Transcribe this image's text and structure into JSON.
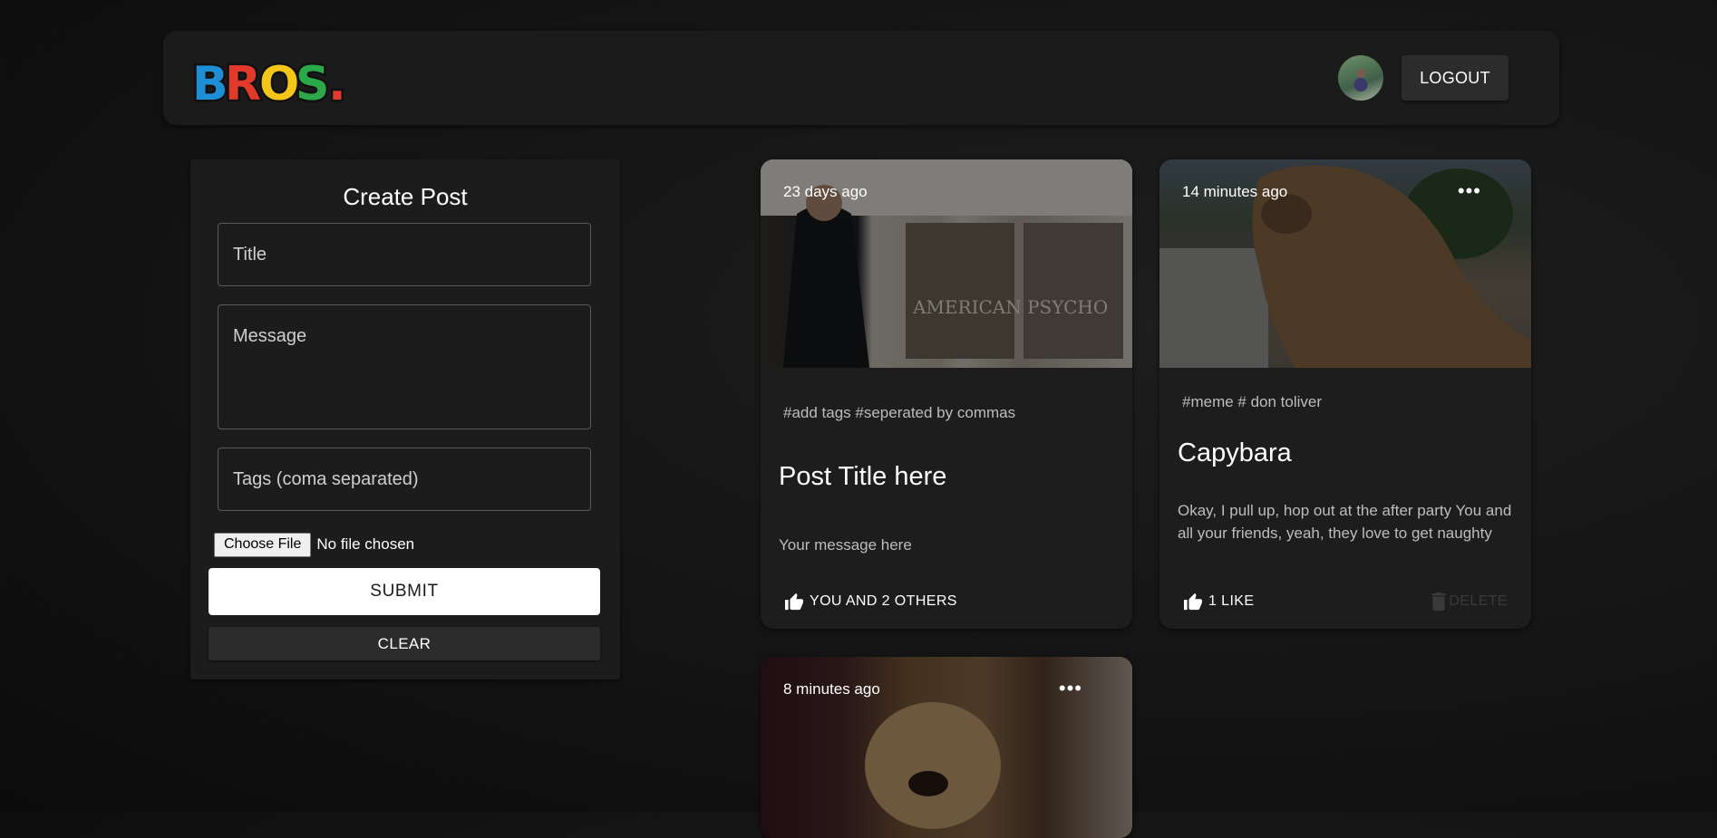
{
  "header": {
    "logo_text": "BROS.",
    "logout_label": "LOGOUT"
  },
  "create_post": {
    "heading": "Create Post",
    "title_placeholder": "Title",
    "message_placeholder": "Message",
    "tags_placeholder": "Tags (coma separated)",
    "file_button": "Choose File",
    "file_status": "No file chosen",
    "submit_label": "SUBMIT",
    "clear_label": "CLEAR"
  },
  "posts": [
    {
      "time": "23 days ago",
      "tags": "#add tags #seperated by commas",
      "title": "Post Title here",
      "message": "Your message here",
      "likes": "YOU AND 2 OTHERS",
      "image_text": "AMERICAN PSYCHO"
    },
    {
      "time": "14 minutes ago",
      "more": "•••",
      "tags": "#meme # don toliver",
      "title": "Capybara",
      "message": "Okay, I pull up, hop out at the after party You and all your friends, yeah, they love to get naughty",
      "likes": "1 LIKE",
      "delete": "DELETE"
    },
    {
      "time": "8 minutes ago",
      "more": "•••"
    }
  ],
  "colors": {
    "logo_b": "#1e8fd6",
    "logo_r": "#e23a2a",
    "logo_o": "#f5c518",
    "logo_s": "#2aa84a",
    "logo_dot": "#e23a2a"
  }
}
